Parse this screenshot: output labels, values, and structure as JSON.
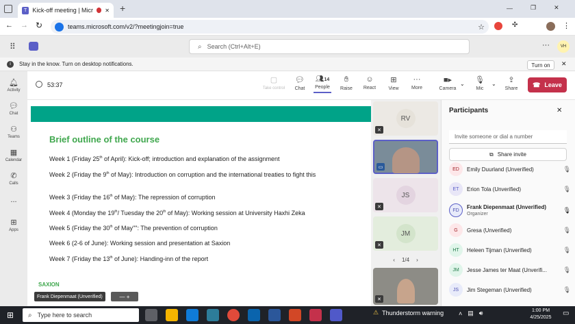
{
  "browser": {
    "tab_title": "Kick-off meeting | Microsoft",
    "new_tab": "+",
    "url": "teams.microsoft.com/v2/?meetingjoin=true",
    "controls": [
      "—",
      "❐",
      "✕"
    ]
  },
  "teams": {
    "search_placeholder": "Search (Ctrl+Alt+E)",
    "notification": "Stay in the know. Turn on desktop notifications.",
    "turn_on": "Turn on"
  },
  "rail": [
    {
      "label": "Activity",
      "icon": "bell-icon"
    },
    {
      "label": "Chat",
      "icon": "chat-icon"
    },
    {
      "label": "Teams",
      "icon": "teams-icon"
    },
    {
      "label": "Calendar",
      "icon": "calendar-icon"
    },
    {
      "label": "Calls",
      "icon": "phone-icon"
    },
    {
      "label": "...",
      "icon": "more-icon"
    },
    {
      "label": "Apps",
      "icon": "apps-icon"
    }
  ],
  "meeting": {
    "timer": "53:37",
    "take_control": "Take control",
    "chat": "Chat",
    "people": "People",
    "people_count": "14",
    "raise": "Raise",
    "react": "React",
    "view": "View",
    "more": "More",
    "camera": "Camera",
    "mic": "Mic",
    "share": "Share",
    "leave": "Leave"
  },
  "slide": {
    "title": "Brief outline of the course",
    "weeks": [
      {
        "a": "Week 1 (Friday 25",
        "sup": "th",
        "b": " of April): Kick-off; introduction and explanation of the assignment"
      },
      {
        "a": "Week 2 (Friday the 9",
        "sup": "th",
        "b": " of May): Introduction on corruption and the international treaties to fight this"
      },
      {
        "a": "Week 3 (Friday the 16",
        "sup": "th",
        "b": " of May): The repression of corruption"
      },
      {
        "a": "Week 4 (Monday the 19",
        "sup": "th",
        "b": "/ Tuesday the 20",
        "sup2": "th",
        "c": " of May): Working session at University Haxhi Zeka"
      },
      {
        "a": "Week 5 (Friday the 30",
        "sup": "th",
        "b": " of May\"\": The prevention of corruption"
      },
      {
        "a": "Week 6 (2-6 of June): Working session and presentation at Saxion",
        "sup": "",
        "b": ""
      },
      {
        "a": "Week 7 (Friday the 13",
        "sup": "th",
        "b": " of June): Handing-inn of the report"
      }
    ],
    "logo": "SAXION",
    "speaker": "Frank Diepenmaat (Unverified)",
    "speaker_ctrl": "—   +"
  },
  "gallery": {
    "tiles": [
      "RV",
      "JS",
      "JM"
    ],
    "pager": "1/4"
  },
  "participants": {
    "title": "Participants",
    "invite_placeholder": "Invite someone or dial a number",
    "share_invite": "Share invite",
    "list": [
      {
        "initials": "ED",
        "name": "Emily Duurland (Unverified)",
        "color": "#fde7e9",
        "fg": "#a4262c",
        "muted": true
      },
      {
        "initials": "ET",
        "name": "Erion Tola (Unverified)",
        "color": "#e8e6f7",
        "fg": "#5b5fc7",
        "muted": true
      },
      {
        "initials": "FD",
        "name": "Frank Diepenmaat (Unverified)",
        "sub": "Organizer",
        "color": "#e8ebfa",
        "fg": "#4f52b2",
        "muted": false
      },
      {
        "initials": "G",
        "name": "Gresa (Unverified)",
        "color": "#fde7e9",
        "fg": "#a4262c",
        "muted": true
      },
      {
        "initials": "HT",
        "name": "Heleen Tijman (Unverified)",
        "color": "#e0f5ea",
        "fg": "#237b4b",
        "muted": true
      },
      {
        "initials": "JM",
        "name": "Jesse James ter Maat (Unverifi...",
        "color": "#e0f5ea",
        "fg": "#237b4b",
        "muted": true
      },
      {
        "initials": "JS",
        "name": "Jim Stegeman (Unverified)",
        "color": "#e8ebfa",
        "fg": "#4f52b2",
        "muted": true
      }
    ]
  },
  "taskbar": {
    "search": "Type here to search",
    "weather": "Thunderstorm warning",
    "time": "1:00 PM",
    "date": "4/25/2025"
  }
}
